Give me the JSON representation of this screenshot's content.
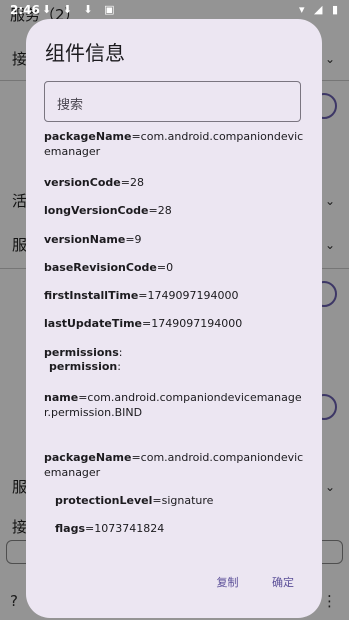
{
  "status_bar": {
    "time": "2:46",
    "notifications": "⬇ ⬇ ⬇ ▣",
    "right_icons": "▾ ◢ ▮"
  },
  "background": {
    "top_label": "服务（2）",
    "row1": "接",
    "row2": "活",
    "row3": "服",
    "row4": "服",
    "row5": "接"
  },
  "dialog": {
    "title": "组件信息",
    "search_placeholder": "搜索",
    "lines": [
      {
        "key": "packageName",
        "value": "=com.android.companiondevicemanager"
      },
      {
        "key": "versionCode",
        "value": "=28"
      },
      {
        "key": "longVersionCode",
        "value": "=28"
      },
      {
        "key": "versionName",
        "value": "=9"
      },
      {
        "key": "baseRevisionCode",
        "value": "=0"
      },
      {
        "key": "firstInstallTime",
        "value": "=1749097194000"
      },
      {
        "key": "lastUpdateTime",
        "value": "=1749097194000"
      },
      {
        "key": "permissions",
        "value": ":"
      },
      {
        "key": "permission",
        "value": ":"
      },
      {
        "key": "name",
        "value": "=com.android.companiondevicemanager.permission.BIND"
      },
      {
        "key": "packageName",
        "value": "=com.android.companiondevicemanager"
      },
      {
        "key": "protectionLevel",
        "value": "=signature"
      },
      {
        "key": "flags",
        "value": "=1073741824"
      }
    ],
    "copy_label": "复制",
    "confirm_label": "确定"
  }
}
